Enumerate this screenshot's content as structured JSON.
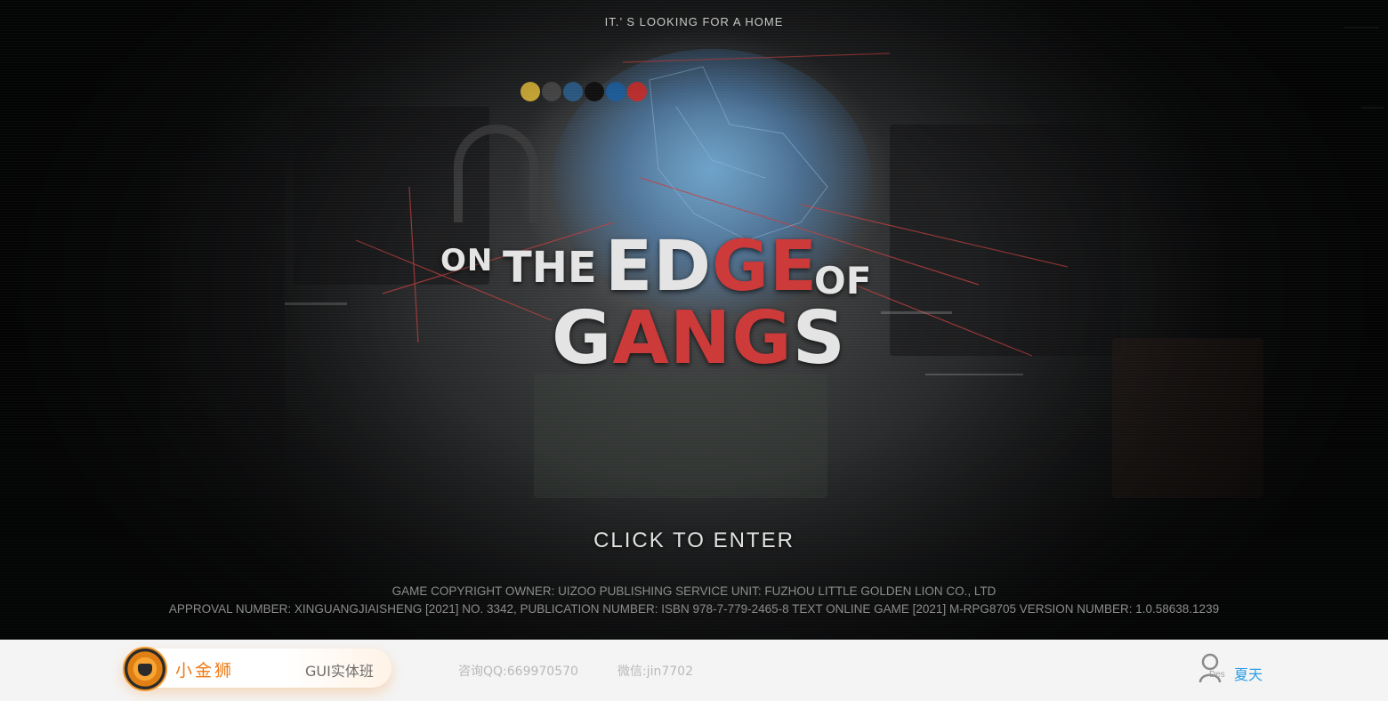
{
  "hero": {
    "tagline": "IT.’ S LOOKING FOR A HOME",
    "logo": {
      "on": "ON",
      "the": "THE",
      "edge_a": "ED",
      "edge_b": "GE",
      "of": "OF",
      "gangs_a": "G",
      "gangs_b": "ANG",
      "gangs_c": "S"
    },
    "enter_label": "CLICK TO ENTER",
    "copyright_line1": "GAME COPYRIGHT OWNER: UIZOO PUBLISHING SERVICE UNIT: FUZHOU LITTLE GOLDEN LION CO., LTD",
    "copyright_line2": "APPROVAL NUMBER: XINGUANGJIAISHENG [2021] NO. 3342, PUBLICATION NUMBER: ISBN 978-7-779-2465-8 TEXT ONLINE GAME [2021] M-RPG8705 VERSION NUMBER: 1.0.58638.1239"
  },
  "footer": {
    "brand_name": "小金狮",
    "brand_course": "GUI实体班",
    "qq": "咨询QQ:669970570",
    "wechat": "微信:jin7702",
    "user_sub": "Des",
    "user_name": "夏天"
  },
  "colors": {
    "accent_red": "#cc3a3a",
    "brand_orange": "#ef7a17",
    "link_blue": "#2a9de8",
    "bar_bg": "#f4f4f4"
  },
  "icons": {
    "brand": "lion-logo-icon",
    "user": "user-icon"
  }
}
